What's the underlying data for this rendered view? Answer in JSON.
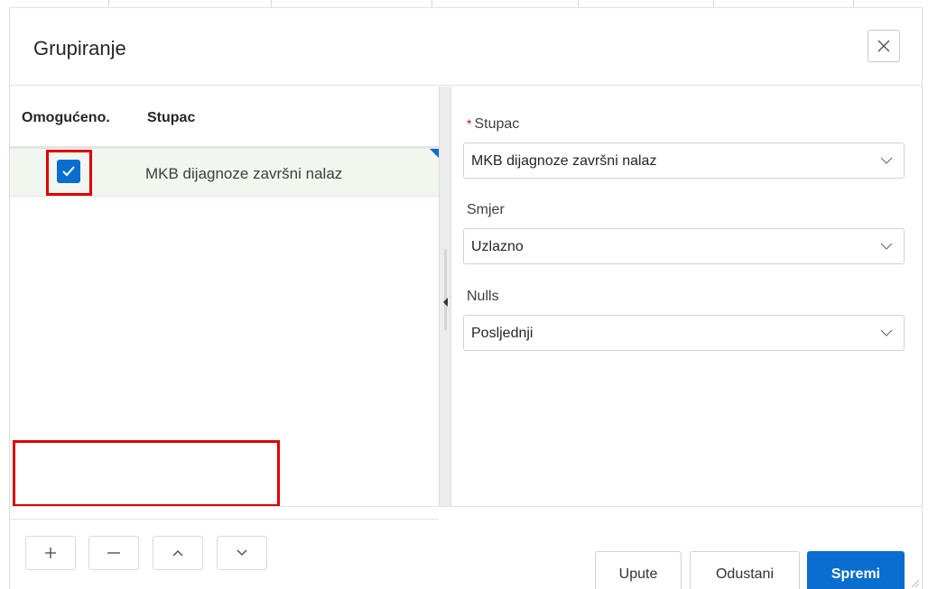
{
  "dialog": {
    "title": "Grupiranje",
    "close_icon": "close-icon"
  },
  "grid": {
    "columns": [
      "Omogućeno.",
      "Stupac"
    ],
    "rows": [
      {
        "enabled": true,
        "column": "MKB dijagnoze završni nalaz"
      }
    ]
  },
  "toolbar": {
    "add_icon": "plus-icon",
    "remove_icon": "minus-icon",
    "move_up_icon": "chevron-up-icon",
    "move_down_icon": "chevron-down-icon"
  },
  "form": {
    "column_label": "Stupac",
    "column_required_marker": "*",
    "column_value": "MKB dijagnoze završni nalaz",
    "direction_label": "Smjer",
    "direction_value": "Uzlazno",
    "nulls_label": "Nulls",
    "nulls_value": "Posljednji"
  },
  "footer": {
    "help_label": "Upute",
    "cancel_label": "Odustani",
    "save_label": "Spremi"
  },
  "colors": {
    "accent": "#0a6ed1",
    "highlight": "#e00000",
    "selected_row": "#f1f6ef"
  }
}
